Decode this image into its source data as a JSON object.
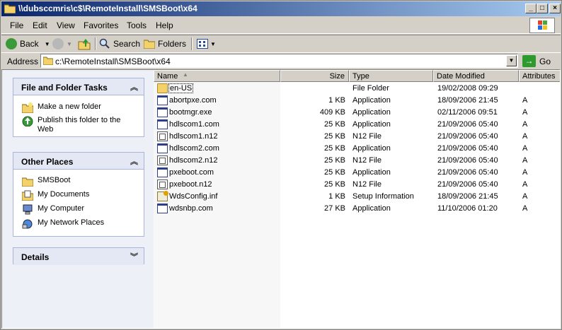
{
  "window": {
    "title": "\\\\dubsccmris\\c$\\RemoteInstall\\SMSBoot\\x64"
  },
  "menu": [
    "File",
    "Edit",
    "View",
    "Favorites",
    "Tools",
    "Help"
  ],
  "toolbar": {
    "back": "Back",
    "search": "Search",
    "folders": "Folders"
  },
  "address": {
    "label": "Address",
    "value": "c:\\RemoteInstall\\SMSBoot\\x64",
    "go": "Go"
  },
  "tasks": {
    "file_folder": {
      "title": "File and Folder Tasks",
      "items": [
        "Make a new folder",
        "Publish this folder to the Web"
      ]
    },
    "other_places": {
      "title": "Other Places",
      "items": [
        "SMSBoot",
        "My Documents",
        "My Computer",
        "My Network Places"
      ]
    },
    "details": {
      "title": "Details"
    }
  },
  "columns": {
    "name": "Name",
    "size": "Size",
    "type": "Type",
    "modified": "Date Modified",
    "attributes": "Attributes"
  },
  "files": [
    {
      "name": "en-US",
      "size": "",
      "type": "File Folder",
      "modified": "19/02/2008 09:29",
      "attr": "",
      "icon": "folder-icon"
    },
    {
      "name": "abortpxe.com",
      "size": "1 KB",
      "type": "Application",
      "modified": "18/09/2006 21:45",
      "attr": "A",
      "icon": "application-icon"
    },
    {
      "name": "bootmgr.exe",
      "size": "409 KB",
      "type": "Application",
      "modified": "02/11/2006 09:51",
      "attr": "A",
      "icon": "application-icon"
    },
    {
      "name": "hdlscom1.com",
      "size": "25 KB",
      "type": "Application",
      "modified": "21/09/2006 05:40",
      "attr": "A",
      "icon": "application-icon"
    },
    {
      "name": "hdlscom1.n12",
      "size": "25 KB",
      "type": "N12 File",
      "modified": "21/09/2006 05:40",
      "attr": "A",
      "icon": "n12-file-icon"
    },
    {
      "name": "hdlscom2.com",
      "size": "25 KB",
      "type": "Application",
      "modified": "21/09/2006 05:40",
      "attr": "A",
      "icon": "application-icon"
    },
    {
      "name": "hdlscom2.n12",
      "size": "25 KB",
      "type": "N12 File",
      "modified": "21/09/2006 05:40",
      "attr": "A",
      "icon": "n12-file-icon"
    },
    {
      "name": "pxeboot.com",
      "size": "25 KB",
      "type": "Application",
      "modified": "21/09/2006 05:40",
      "attr": "A",
      "icon": "application-icon"
    },
    {
      "name": "pxeboot.n12",
      "size": "25 KB",
      "type": "N12 File",
      "modified": "21/09/2006 05:40",
      "attr": "A",
      "icon": "n12-file-icon"
    },
    {
      "name": "WdsConfig.inf",
      "size": "1 KB",
      "type": "Setup Information",
      "modified": "18/09/2006 21:45",
      "attr": "A",
      "icon": "setup-information-icon"
    },
    {
      "name": "wdsnbp.com",
      "size": "27 KB",
      "type": "Application",
      "modified": "11/10/2006 01:20",
      "attr": "A",
      "icon": "application-icon"
    }
  ]
}
